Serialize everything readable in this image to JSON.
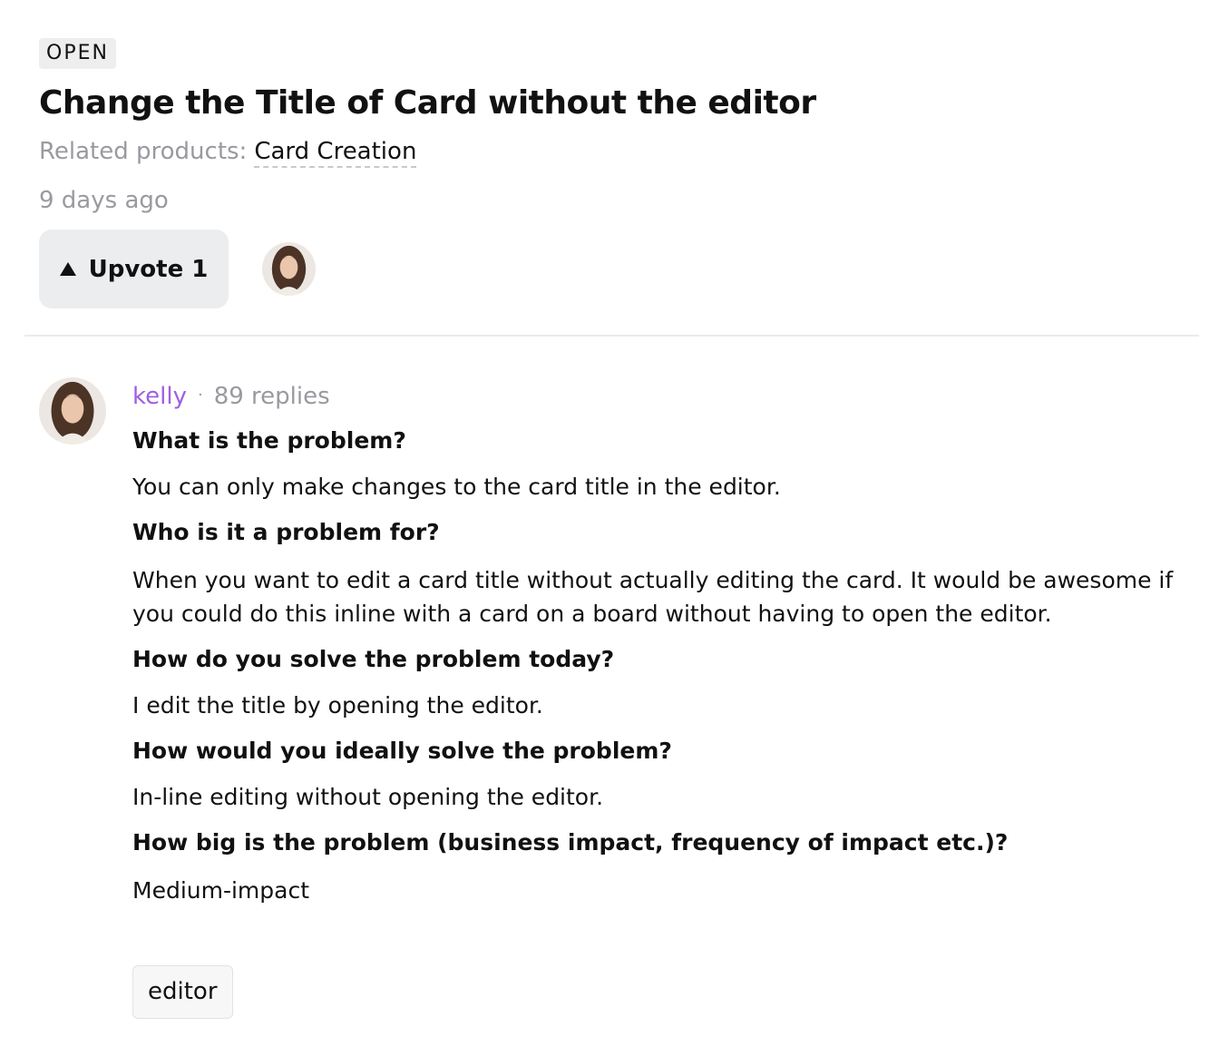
{
  "status": "OPEN",
  "title": "Change the Title of Card without the editor",
  "related_products": {
    "label": "Related products:",
    "product": "Card Creation"
  },
  "timestamp": "9 days ago",
  "upvote": {
    "label": "Upvote 1",
    "icon": "triangle-up-icon"
  },
  "post": {
    "author": "kelly",
    "separator": "·",
    "replies": "89 replies",
    "sections": [
      {
        "question": "What is the problem?",
        "answer": "You can only make changes to the card title in the editor."
      },
      {
        "question": "Who is it a problem for?",
        "answer": "When you want to edit a card title without actually editing the card. It would be awesome if you could do this inline with a card on a board without having to open the editor."
      },
      {
        "question": "How do you solve the problem today?",
        "answer": "I edit the title by opening the editor."
      },
      {
        "question": "How would you ideally solve the problem?",
        "answer": "In-line editing without opening the editor."
      },
      {
        "question": "How big is the problem (business impact, frequency of impact etc.)?",
        "answer": "Medium-impact"
      }
    ],
    "tags": [
      "editor"
    ]
  },
  "colors": {
    "author_link": "#9f5fe0",
    "muted_text": "#999aa0",
    "button_bg": "#ecedef"
  }
}
